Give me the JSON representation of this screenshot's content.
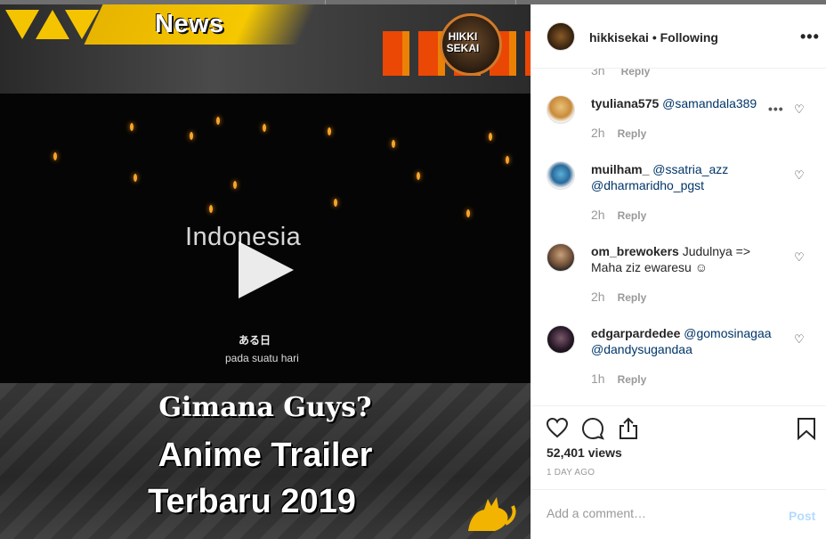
{
  "media": {
    "banner_title": "News",
    "logo_text": "HIKKI SEKAI",
    "video_title": "Indonesia",
    "video_jp": "ある日",
    "video_sub": "pada suatu hari",
    "bottom_line1": "Gimana Guys?",
    "bottom_line2": "Anime Trailer",
    "bottom_line3": "Terbaru 2019",
    "icons": [
      "play-icon"
    ]
  },
  "header": {
    "username": "hikkisekai",
    "separator": " • ",
    "follow_status": "Following",
    "more_label": "•••"
  },
  "comments": {
    "partial": {
      "time": "3h",
      "reply": "Reply"
    },
    "items": [
      {
        "user": "tyuliana575",
        "text": "@samandala389",
        "time": "2h",
        "reply": "Reply",
        "more": "•••"
      },
      {
        "user": "muilham_",
        "text": "@ssatria_azz @dharmaridho_pgst",
        "time": "2h",
        "reply": "Reply"
      },
      {
        "user": "om_brewokers",
        "text": "Judulnya => Maha ziz ewaresu ☺",
        "time": "2h",
        "reply": "Reply"
      },
      {
        "user": "edgarpardedee",
        "text": "@gomosinagaa @dandysugandaa",
        "time": "1h",
        "reply": "Reply"
      }
    ],
    "heart": "♡"
  },
  "actions": {
    "icons": [
      "heart-icon",
      "comment-icon",
      "share-icon",
      "bookmark-icon"
    ]
  },
  "stats": {
    "views": "52,401 views",
    "ago": "1 DAY AGO"
  },
  "add_comment": {
    "placeholder": "Add a comment…",
    "post_label": "Post"
  },
  "colors": {
    "accent_yellow": "#f5c400",
    "link": "#003569",
    "post_disabled": "#b3dbff"
  }
}
